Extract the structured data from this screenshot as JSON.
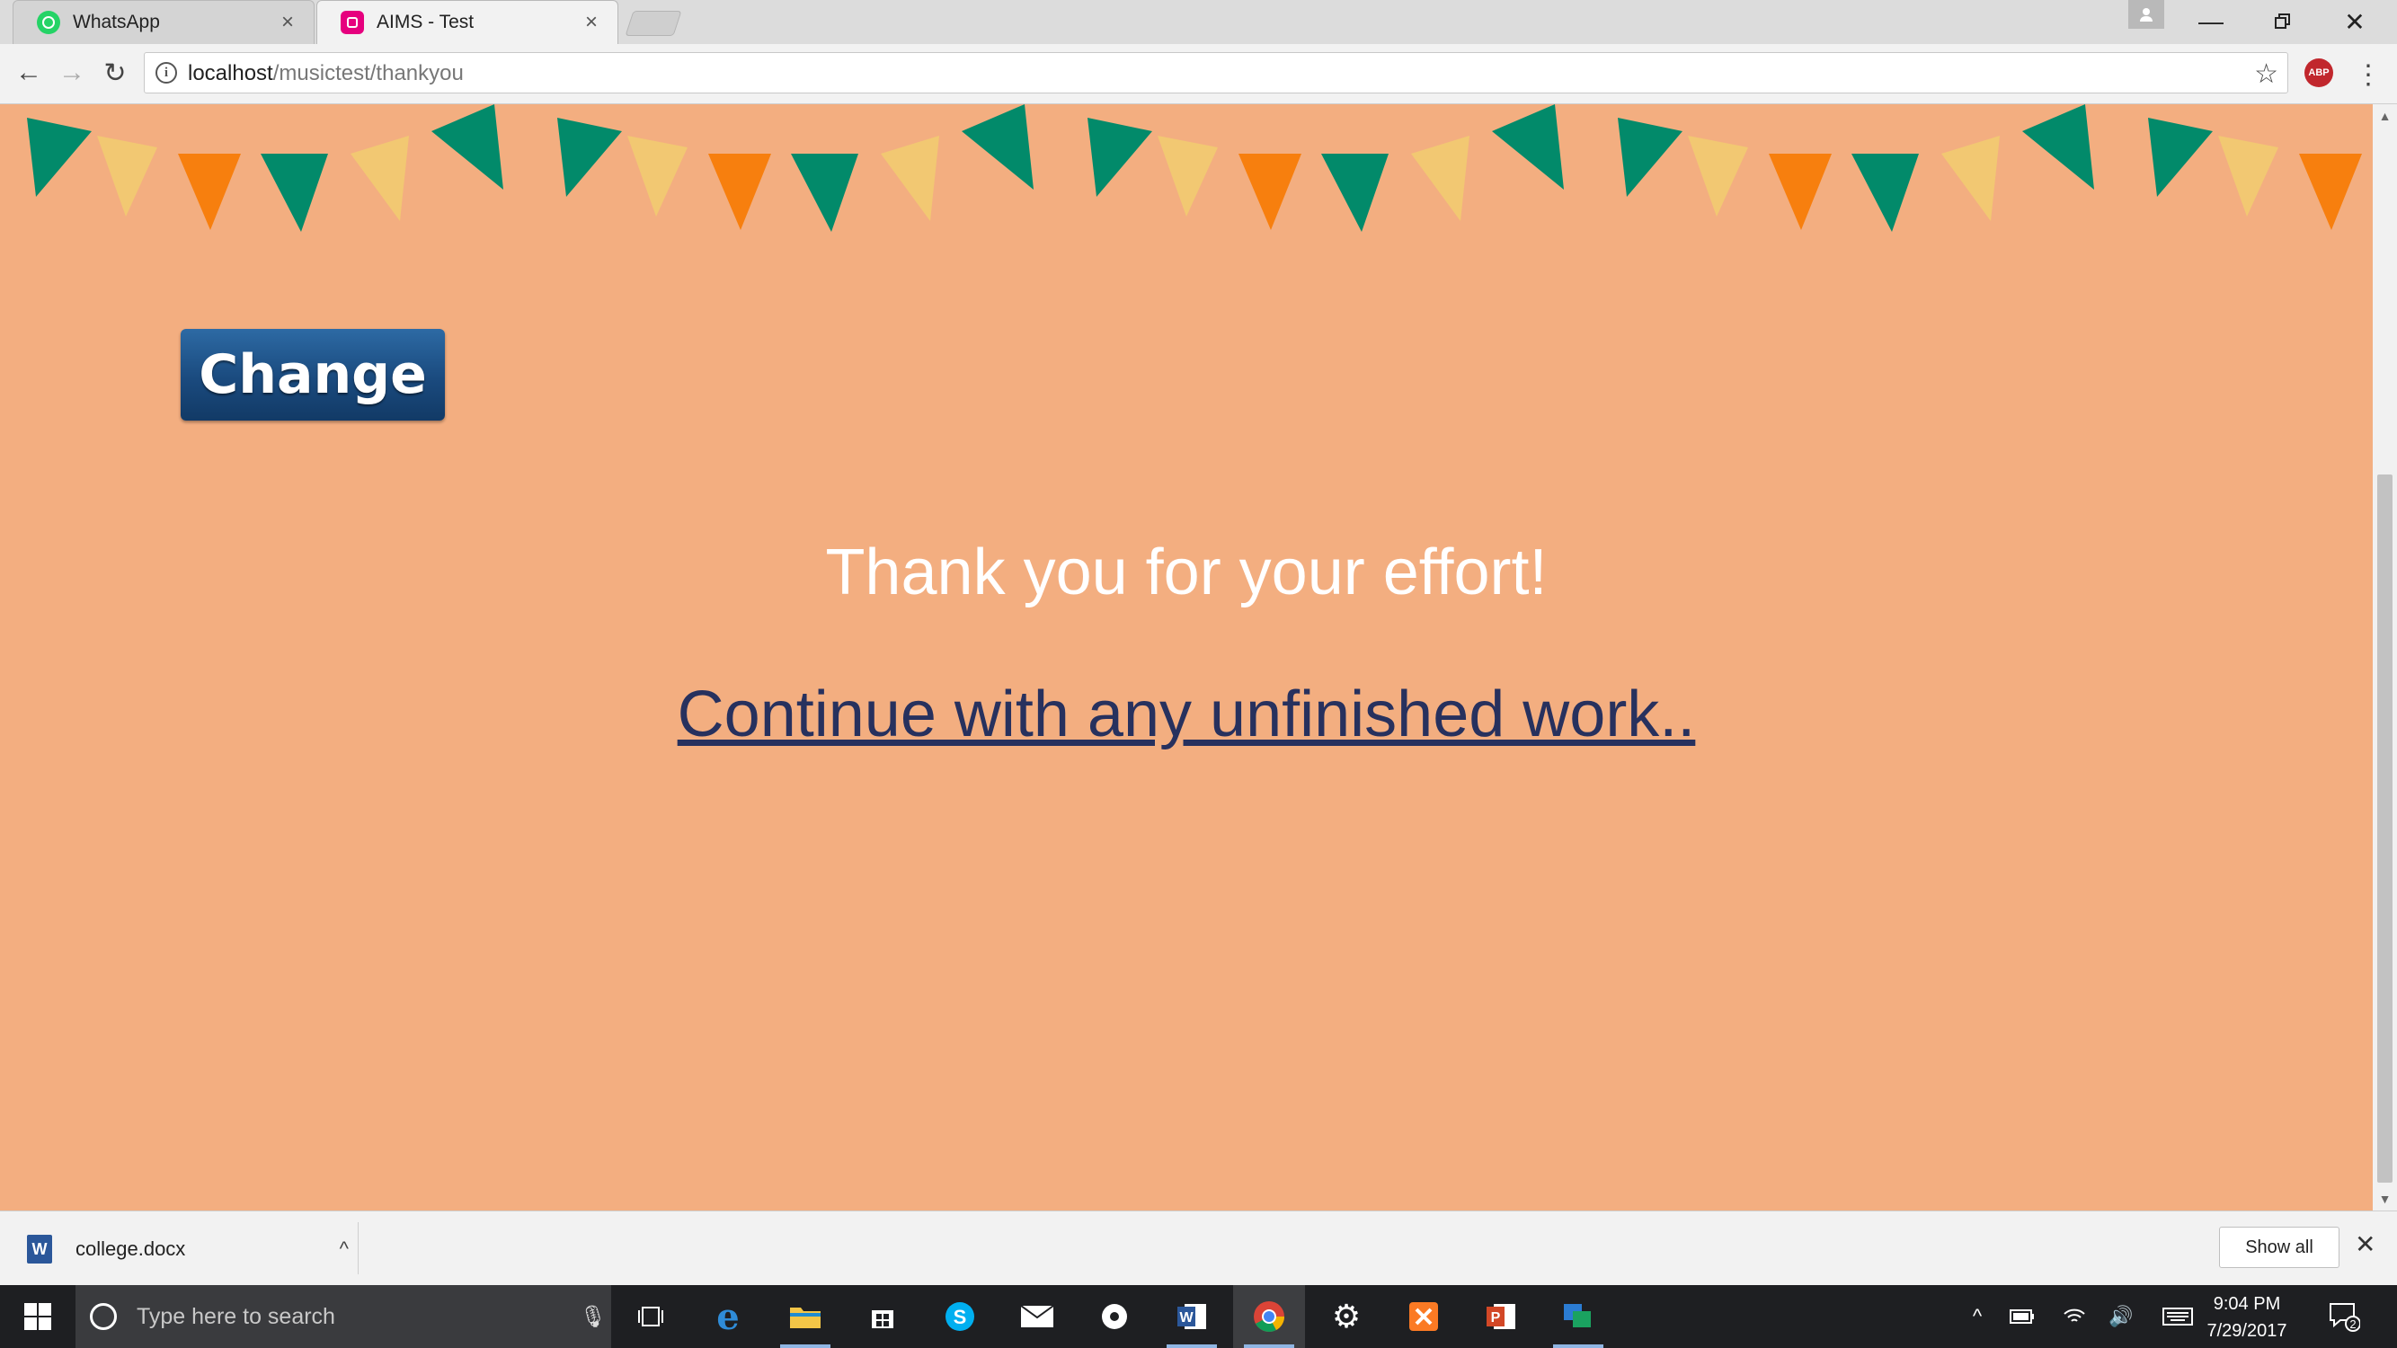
{
  "browser": {
    "tabs": [
      {
        "title": "WhatsApp",
        "favicon": "whatsapp-icon",
        "active": false
      },
      {
        "title": "AIMS - Test",
        "favicon": "aims-icon",
        "active": true
      }
    ],
    "address": {
      "host": "localhost",
      "path": "/musictest/thankyou"
    },
    "abp_label": "ABP"
  },
  "page": {
    "change_button_label": "Change",
    "thanks_text": "Thank you for your effort!",
    "continue_link_text": "Continue with any unfinished work..",
    "bunting_colors": {
      "green": "#028a6a",
      "yellow": "#f2c872",
      "orange": "#f77f0e"
    }
  },
  "download_bar": {
    "file_name": "college.docx",
    "show_all_label": "Show all"
  },
  "taskbar": {
    "search_placeholder": "Type here to search",
    "time": "9:04 PM",
    "date": "7/29/2017",
    "notification_count": "2",
    "apps": [
      "task-view",
      "edge",
      "file-explorer",
      "store",
      "skype",
      "mail",
      "app-7",
      "word",
      "chrome",
      "settings",
      "xampp",
      "powerpoint",
      "app-13"
    ]
  }
}
